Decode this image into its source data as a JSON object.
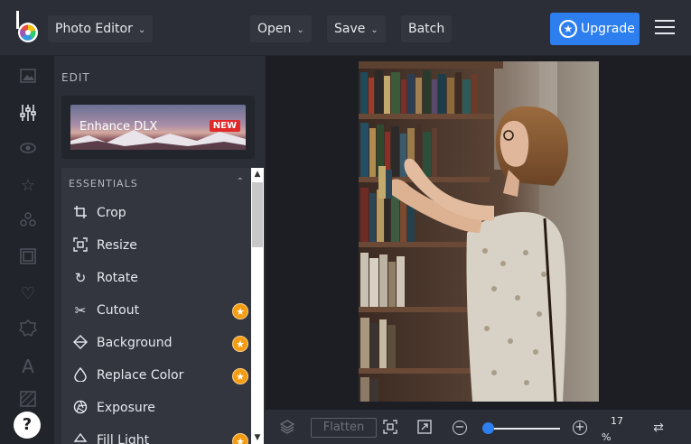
{
  "header": {
    "app_menu_label": "Photo Editor",
    "open_label": "Open",
    "save_label": "Save",
    "batch_label": "Batch",
    "upgrade_label": "Upgrade"
  },
  "rail": {
    "icons": [
      "image-icon",
      "sliders-icon",
      "eye-icon",
      "star-icon",
      "shapes-icon",
      "frame-icon",
      "heart-icon",
      "badge-icon",
      "text-icon",
      "texture-icon"
    ],
    "help_label": "?"
  },
  "panel": {
    "title": "EDIT",
    "promo_text": "Enhance DLX",
    "promo_badge": "NEW",
    "section_title": "ESSENTIALS",
    "tools": [
      {
        "label": "Crop",
        "icon": "crop-icon",
        "premium": false
      },
      {
        "label": "Resize",
        "icon": "resize-icon",
        "premium": false
      },
      {
        "label": "Rotate",
        "icon": "rotate-icon",
        "premium": false
      },
      {
        "label": "Cutout",
        "icon": "scissors-icon",
        "premium": true
      },
      {
        "label": "Background",
        "icon": "eraser-icon",
        "premium": true
      },
      {
        "label": "Replace Color",
        "icon": "drop-icon",
        "premium": true
      },
      {
        "label": "Exposure",
        "icon": "aperture-icon",
        "premium": false
      },
      {
        "label": "Fill Light",
        "icon": "fill-light-icon",
        "premium": true
      }
    ]
  },
  "bottom": {
    "flatten_label": "Flatten",
    "zoom_value": "17",
    "zoom_unit": "%",
    "zoom_level": 0.02
  },
  "colors": {
    "accent": "#2d7ff0",
    "premium": "#f39c12",
    "badge_new": "#e02828"
  }
}
